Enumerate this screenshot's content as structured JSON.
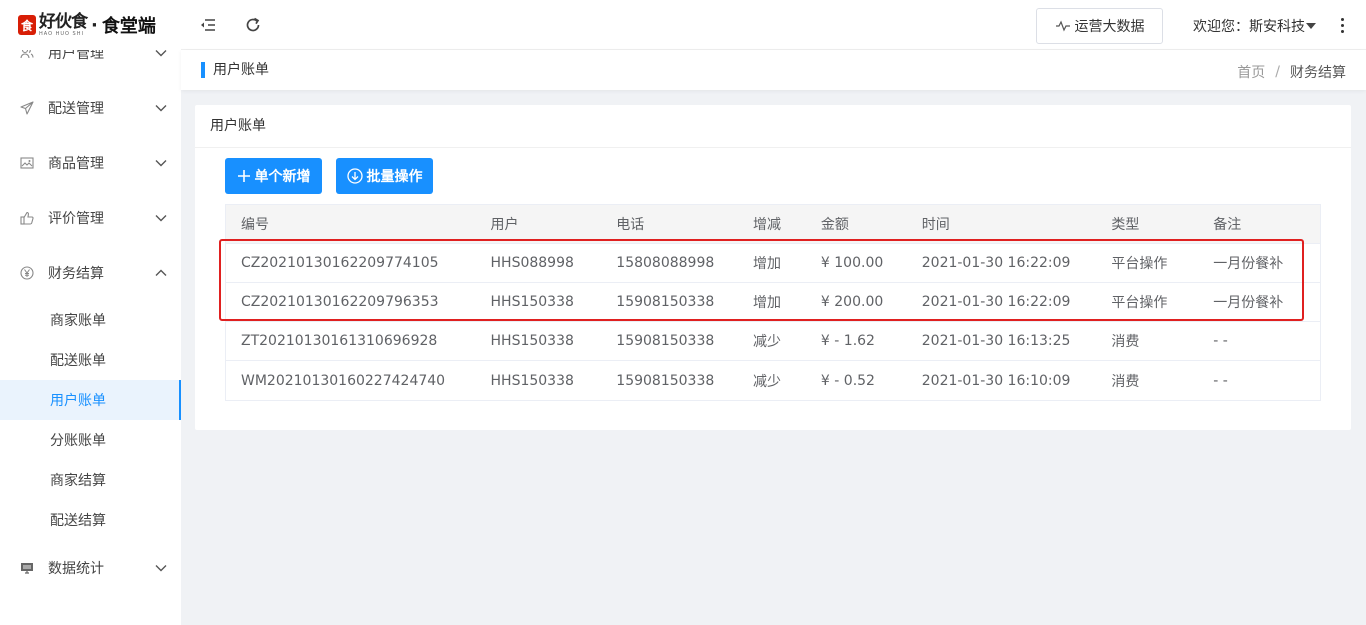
{
  "app": {
    "brand": "好伙食",
    "brand_pinyin": "HAO HUO SHI",
    "separator": "·",
    "subtitle": "食堂端",
    "logo_glyph": "食"
  },
  "sidebar": {
    "groups": [
      {
        "label": "用户管理",
        "icon": "users-icon",
        "expanded": false
      },
      {
        "label": "配送管理",
        "icon": "send-icon",
        "expanded": false
      },
      {
        "label": "商品管理",
        "icon": "image-icon",
        "expanded": false
      },
      {
        "label": "评价管理",
        "icon": "thumbs-up-icon",
        "expanded": false
      },
      {
        "label": "财务结算",
        "icon": "yen-icon",
        "expanded": true
      }
    ],
    "finance_items": [
      {
        "label": "商家账单",
        "active": false
      },
      {
        "label": "配送账单",
        "active": false
      },
      {
        "label": "用户账单",
        "active": true
      },
      {
        "label": "分账账单",
        "active": false
      },
      {
        "label": "商家结算",
        "active": false
      },
      {
        "label": "配送结算",
        "active": false
      }
    ],
    "stats": {
      "label": "数据统计",
      "icon": "monitor-icon",
      "expanded": false
    }
  },
  "header": {
    "bigdata_label": "运营大数据",
    "welcome_text": "欢迎您：斯安科技"
  },
  "crumbbar": {
    "page_title": "用户账单",
    "breadcrumb": [
      "首页",
      "财务结算"
    ]
  },
  "card": {
    "title": "用户账单",
    "add_label": "单个新增",
    "batch_label": "批量操作"
  },
  "table": {
    "columns": [
      "编号",
      "用户",
      "电话",
      "增减",
      "金额",
      "时间",
      "类型",
      "备注"
    ],
    "rows": [
      [
        "CZ20210130162209774105",
        "HHS088998",
        "15808088998",
        "增加",
        "¥ 100.00",
        "2021-01-30 16:22:09",
        "平台操作",
        "一月份餐补"
      ],
      [
        "CZ20210130162209796353",
        "HHS150338",
        "15908150338",
        "增加",
        "¥ 200.00",
        "2021-01-30 16:22:09",
        "平台操作",
        "一月份餐补"
      ],
      [
        "ZT20210130161310696928",
        "HHS150338",
        "15908150338",
        "减少",
        "¥ - 1.62",
        "2021-01-30 16:13:25",
        "消费",
        "- -"
      ],
      [
        "WM20210130160227424740",
        "HHS150338",
        "15908150338",
        "减少",
        "¥ - 0.52",
        "2021-01-30 16:10:09",
        "消费",
        "- -"
      ]
    ]
  },
  "colors": {
    "accent": "#1890ff",
    "highlight": "#e02020",
    "logo_red": "#d81e06"
  }
}
